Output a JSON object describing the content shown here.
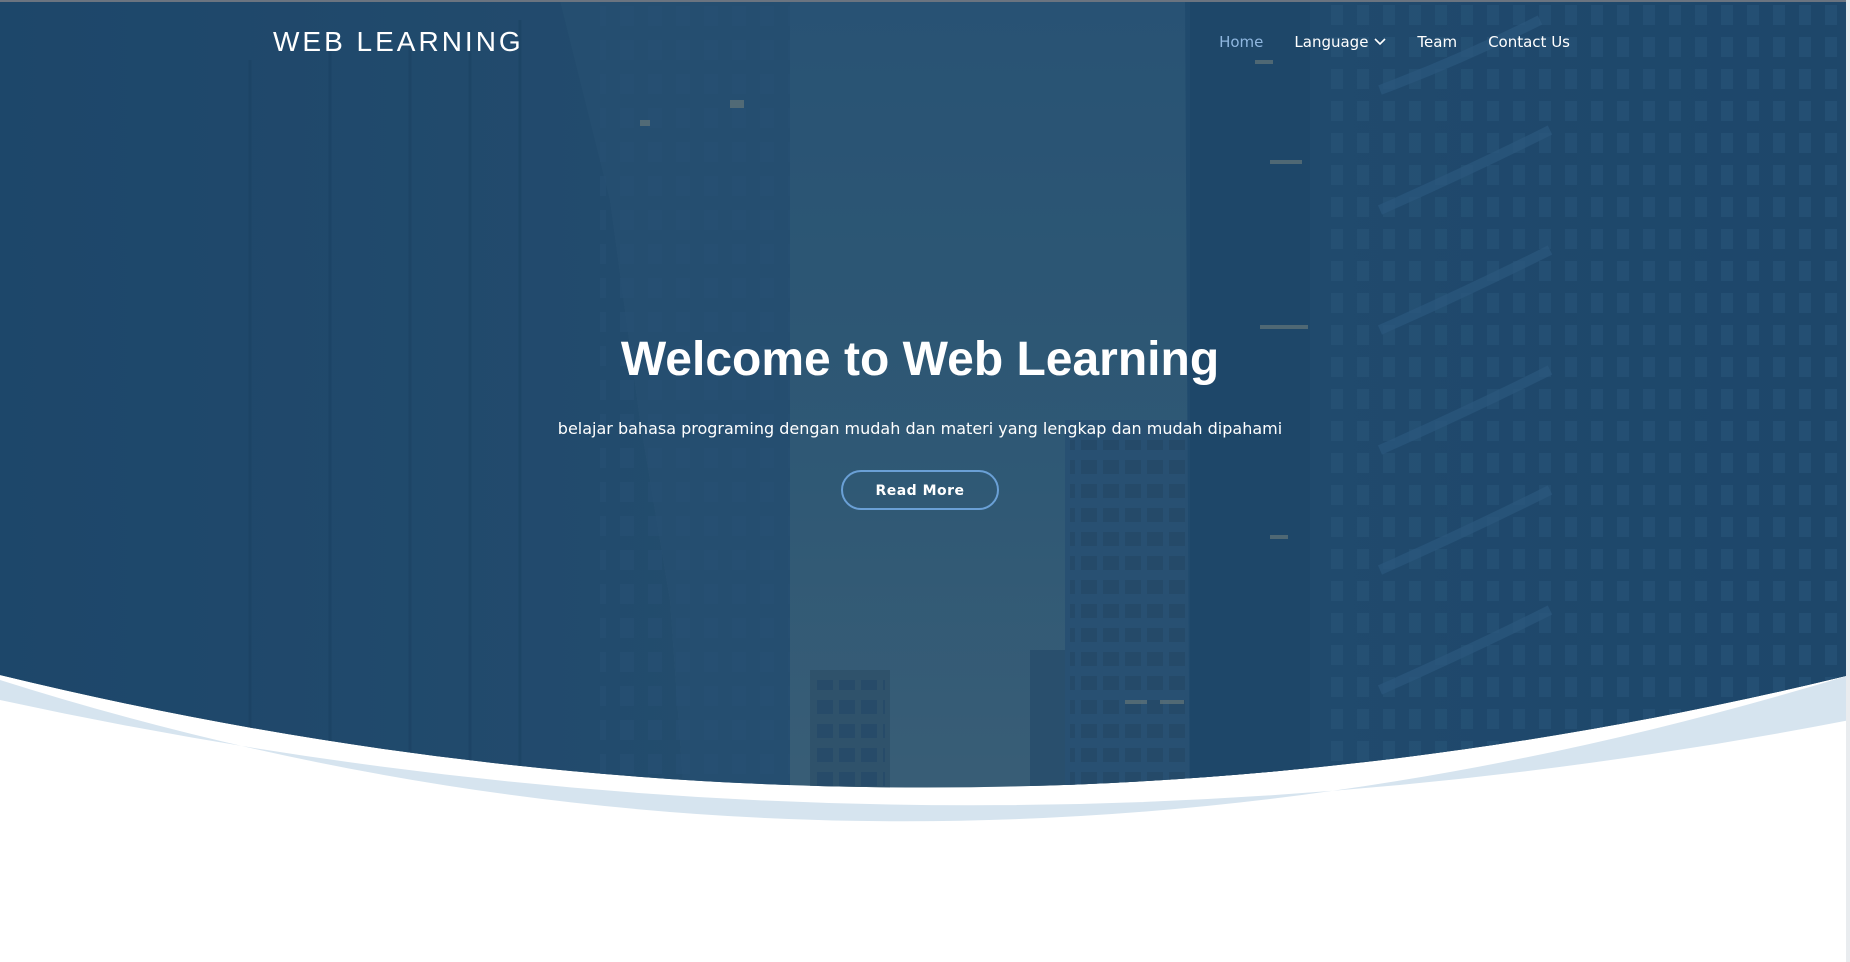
{
  "header": {
    "logo": "WEB LEARNING",
    "nav": [
      {
        "label": "Home",
        "active": true
      },
      {
        "label": "Language",
        "has_dropdown": true
      },
      {
        "label": "Team"
      },
      {
        "label": "Contact Us"
      }
    ]
  },
  "hero": {
    "title": "Welcome to Web Learning",
    "subtitle": "belajar bahasa programing dengan mudah dan materi yang lengkap dan mudah dipahami",
    "cta_label": "Read More",
    "background_icon": "city-buildings-illustration"
  },
  "colors": {
    "hero_overlay": "#244c6e",
    "nav_active": "#8fb7e0",
    "cta_border": "#6aa0d6",
    "wave_light": "#d6e4ef",
    "page_bg": "#ffffff"
  }
}
